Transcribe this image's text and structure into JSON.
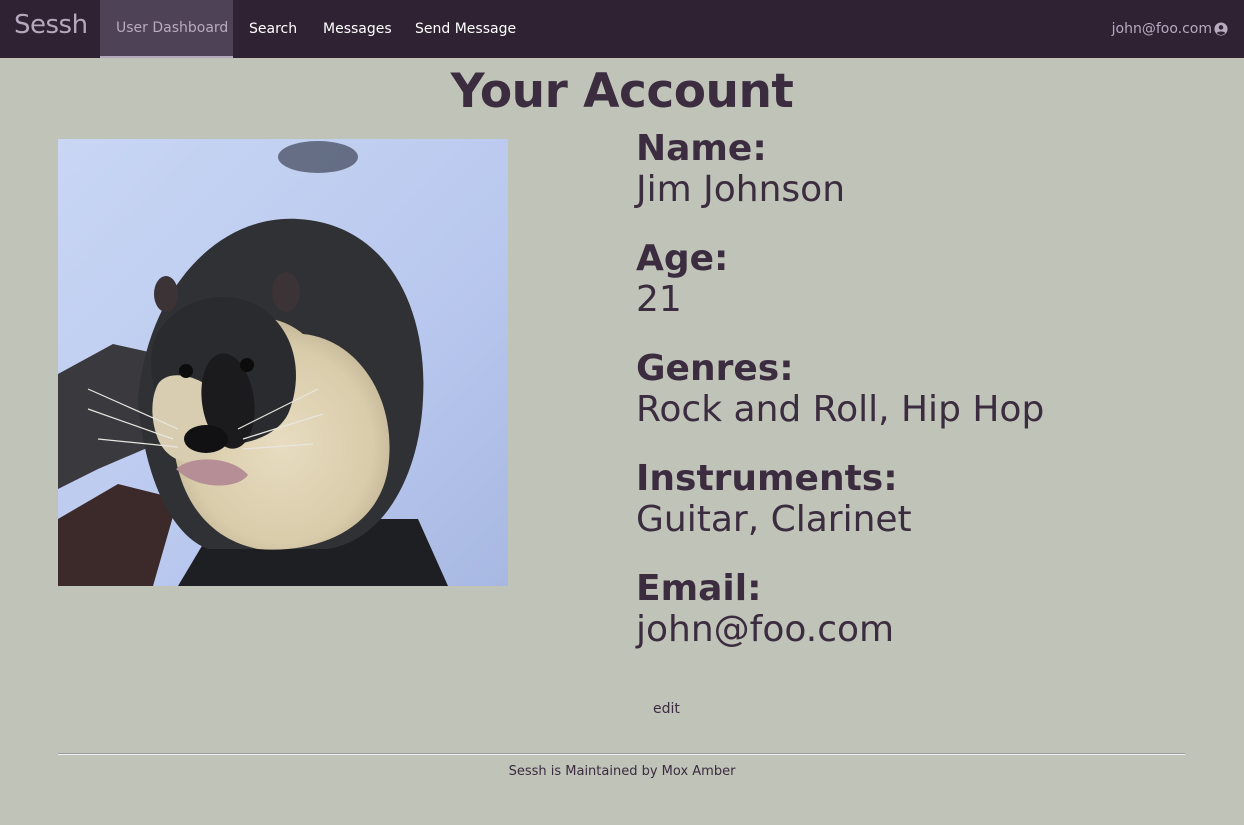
{
  "nav": {
    "brand": "Sessh",
    "items": [
      {
        "label": "User Dashboard",
        "active": true
      },
      {
        "label": "Search",
        "active": false
      },
      {
        "label": "Messages",
        "active": false
      },
      {
        "label": "Send Message",
        "active": false
      }
    ],
    "user_email": "john@foo.com",
    "user_icon": "user-circle-icon"
  },
  "page": {
    "title": "Your Account"
  },
  "profile": {
    "photo": "nutria-photo",
    "fields": [
      {
        "label": "Name:",
        "value": "Jim Johnson"
      },
      {
        "label": "Age:",
        "value": "21"
      },
      {
        "label": "Genres:",
        "value": "Rock and Roll, Hip Hop"
      },
      {
        "label": "Instruments:",
        "value": "Guitar, Clarinet"
      },
      {
        "label": "Email:",
        "value": "john@foo.com"
      }
    ],
    "edit_label": "edit"
  },
  "footer": {
    "text": "Sessh is Maintained by Mox Amber"
  },
  "colors": {
    "navbar_bg": "#2f2233",
    "active_tab_bg": "#4e4256",
    "page_bg": "#bfc3b8",
    "text": "#3b2c3f",
    "brand": "#b7a7bc"
  }
}
